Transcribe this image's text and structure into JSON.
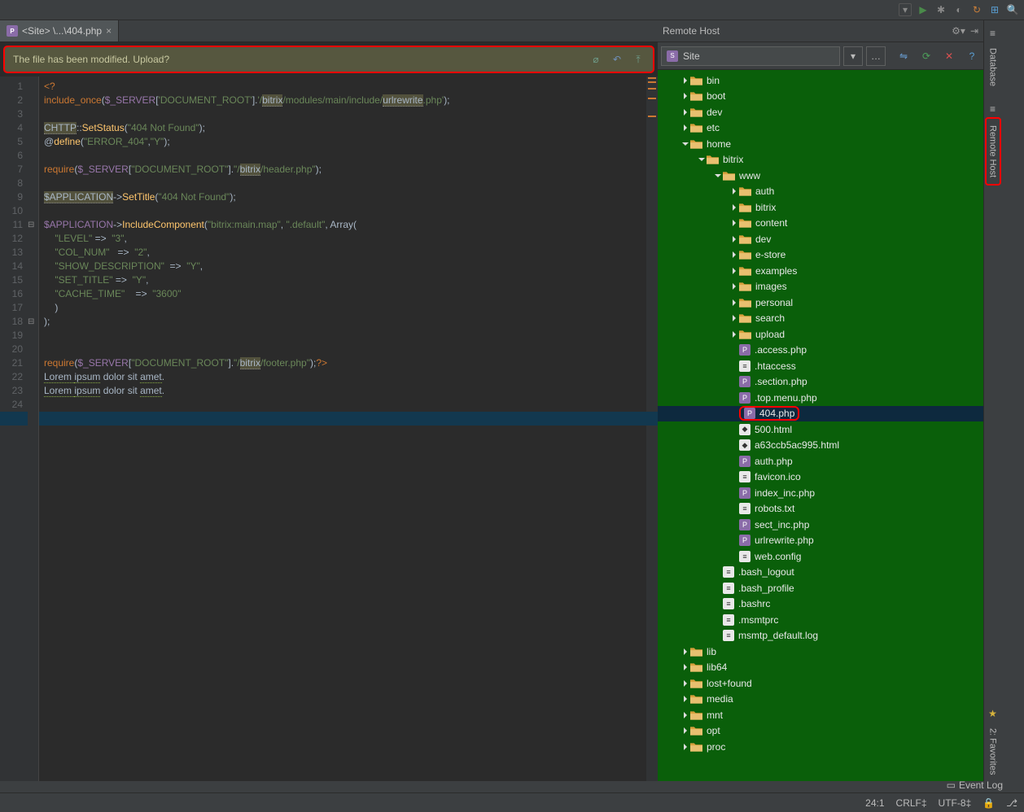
{
  "toolbar_icons": [
    "dropdown",
    "run",
    "debug",
    "cfg",
    "update",
    "grid",
    "search"
  ],
  "tab": {
    "label": "<Site> \\...\\404.php"
  },
  "banner": {
    "text": "The file has been modified. Upload?",
    "icons": [
      "diff-icon",
      "revert-icon",
      "upload-icon"
    ]
  },
  "code_lines": [
    {
      "n": 1,
      "segs": [
        {
          "t": "<?",
          "c": "kw"
        }
      ]
    },
    {
      "n": 2,
      "segs": [
        {
          "t": "include_once",
          "c": "kw"
        },
        {
          "t": "("
        },
        {
          "t": "$_SERVER",
          "c": "var"
        },
        {
          "t": "["
        },
        {
          "t": "'DOCUMENT_ROOT'",
          "c": "str"
        },
        {
          "t": "]."
        },
        {
          "t": "'/",
          "c": "str"
        },
        {
          "t": "bitrix",
          "c": "hl"
        },
        {
          "t": "/modules/main/include/",
          "c": "str"
        },
        {
          "t": "urlrewrite",
          "c": "hl"
        },
        {
          "t": ".php'",
          "c": "str"
        },
        {
          "t": ");"
        }
      ]
    },
    {
      "n": 3,
      "segs": []
    },
    {
      "n": 4,
      "segs": [
        {
          "t": "CHTTP",
          "c": "hl"
        },
        {
          "t": "::"
        },
        {
          "t": "SetStatus",
          "c": "fn"
        },
        {
          "t": "("
        },
        {
          "t": "\"404 Not Found\"",
          "c": "str"
        },
        {
          "t": ");"
        }
      ]
    },
    {
      "n": 5,
      "segs": [
        {
          "t": "@"
        },
        {
          "t": "define",
          "c": "fn"
        },
        {
          "t": "("
        },
        {
          "t": "\"ERROR_404\"",
          "c": "str"
        },
        {
          "t": ","
        },
        {
          "t": "\"Y\"",
          "c": "str"
        },
        {
          "t": ");"
        }
      ]
    },
    {
      "n": 6,
      "segs": []
    },
    {
      "n": 7,
      "segs": [
        {
          "t": "require",
          "c": "kw"
        },
        {
          "t": "("
        },
        {
          "t": "$_SERVER",
          "c": "var"
        },
        {
          "t": "["
        },
        {
          "t": "\"DOCUMENT_ROOT\"",
          "c": "str"
        },
        {
          "t": "]."
        },
        {
          "t": "\"/",
          "c": "str"
        },
        {
          "t": "bitrix",
          "c": "hl"
        },
        {
          "t": "/header.php\"",
          "c": "str"
        },
        {
          "t": ");"
        }
      ]
    },
    {
      "n": 8,
      "segs": []
    },
    {
      "n": 9,
      "segs": [
        {
          "t": "$APPLICATION",
          "c": "hl"
        },
        {
          "t": "->"
        },
        {
          "t": "SetTitle",
          "c": "fn"
        },
        {
          "t": "("
        },
        {
          "t": "\"404 Not Found\"",
          "c": "str"
        },
        {
          "t": ");"
        }
      ]
    },
    {
      "n": 10,
      "segs": []
    },
    {
      "n": 11,
      "segs": [
        {
          "t": "$APPLICATION",
          "c": "var"
        },
        {
          "t": "->"
        },
        {
          "t": "IncludeComponent",
          "c": "fn"
        },
        {
          "t": "("
        },
        {
          "t": "\"bitrix:main.map\"",
          "c": "str"
        },
        {
          "t": ", "
        },
        {
          "t": "\".default\"",
          "c": "str"
        },
        {
          "t": ", "
        },
        {
          "t": "Array",
          "c": ""
        },
        {
          "t": "("
        }
      ]
    },
    {
      "n": 12,
      "segs": [
        {
          "t": "    "
        },
        {
          "t": "\"LEVEL\"",
          "c": "str"
        },
        {
          "t": " =>  "
        },
        {
          "t": "\"3\"",
          "c": "str"
        },
        {
          "t": ","
        }
      ]
    },
    {
      "n": 13,
      "segs": [
        {
          "t": "    "
        },
        {
          "t": "\"COL_NUM\"",
          "c": "str"
        },
        {
          "t": "   =>  "
        },
        {
          "t": "\"2\"",
          "c": "str"
        },
        {
          "t": ","
        }
      ]
    },
    {
      "n": 14,
      "segs": [
        {
          "t": "    "
        },
        {
          "t": "\"SHOW_DESCRIPTION\"",
          "c": "str"
        },
        {
          "t": "  =>  "
        },
        {
          "t": "\"Y\"",
          "c": "str"
        },
        {
          "t": ","
        }
      ]
    },
    {
      "n": 15,
      "segs": [
        {
          "t": "    "
        },
        {
          "t": "\"SET_TITLE\"",
          "c": "str"
        },
        {
          "t": " =>  "
        },
        {
          "t": "\"Y\"",
          "c": "str"
        },
        {
          "t": ","
        }
      ]
    },
    {
      "n": 16,
      "segs": [
        {
          "t": "    "
        },
        {
          "t": "\"CACHE_TIME\"",
          "c": "str"
        },
        {
          "t": "    =>  "
        },
        {
          "t": "\"3600\"",
          "c": "str"
        }
      ]
    },
    {
      "n": 17,
      "segs": [
        {
          "t": "    )"
        }
      ]
    },
    {
      "n": 18,
      "segs": [
        {
          "t": ");"
        }
      ]
    },
    {
      "n": 19,
      "segs": []
    },
    {
      "n": 20,
      "segs": []
    },
    {
      "n": 21,
      "segs": [
        {
          "t": "require",
          "c": "kw"
        },
        {
          "t": "("
        },
        {
          "t": "$_SERVER",
          "c": "var"
        },
        {
          "t": "["
        },
        {
          "t": "\"DOCUMENT_ROOT\"",
          "c": "str"
        },
        {
          "t": "]."
        },
        {
          "t": "\"/",
          "c": "str"
        },
        {
          "t": "bitrix",
          "c": "hl"
        },
        {
          "t": "/footer.php\"",
          "c": "str"
        },
        {
          "t": ");"
        },
        {
          "t": "?>",
          "c": "kw"
        }
      ]
    },
    {
      "n": 22,
      "segs": [
        {
          "t": "Lorem ",
          "c": "typo"
        },
        {
          "t": "ipsum",
          "c": "typo"
        },
        {
          "t": " dolor sit "
        },
        {
          "t": "amet",
          "c": "typo"
        },
        {
          "t": "."
        }
      ]
    },
    {
      "n": 23,
      "segs": [
        {
          "t": "Lorem ",
          "c": "typo"
        },
        {
          "t": "ipsum",
          "c": "typo"
        },
        {
          "t": " dolor sit "
        },
        {
          "t": "amet",
          "c": "typo"
        },
        {
          "t": "."
        }
      ]
    },
    {
      "n": 24,
      "segs": []
    },
    {
      "n": 25,
      "segs": []
    }
  ],
  "marker_lines": [
    2,
    4,
    7,
    11,
    21
  ],
  "remote": {
    "title": "Remote Host",
    "combo": "Site",
    "toolbar_icons": [
      {
        "g": "⇋",
        "c": "#6aa0d8"
      },
      {
        "g": "⟳",
        "c": "#4da05a"
      },
      {
        "g": "✕",
        "c": "#d85050"
      },
      {
        "g": "?",
        "c": "#5a9fd4"
      }
    ],
    "tree": [
      {
        "d": 1,
        "a": "r",
        "t": "folder",
        "n": "bin"
      },
      {
        "d": 1,
        "a": "r",
        "t": "folder",
        "n": "boot"
      },
      {
        "d": 1,
        "a": "r",
        "t": "folder",
        "n": "dev"
      },
      {
        "d": 1,
        "a": "r",
        "t": "folder",
        "n": "etc"
      },
      {
        "d": 1,
        "a": "d",
        "t": "folder",
        "n": "home"
      },
      {
        "d": 2,
        "a": "d",
        "t": "folder",
        "n": "bitrix"
      },
      {
        "d": 3,
        "a": "d",
        "t": "folder",
        "n": "www"
      },
      {
        "d": 4,
        "a": "r",
        "t": "folder",
        "n": "auth"
      },
      {
        "d": 4,
        "a": "r",
        "t": "folder",
        "n": "bitrix"
      },
      {
        "d": 4,
        "a": "r",
        "t": "folder",
        "n": "content"
      },
      {
        "d": 4,
        "a": "r",
        "t": "folder",
        "n": "dev"
      },
      {
        "d": 4,
        "a": "r",
        "t": "folder",
        "n": "e-store"
      },
      {
        "d": 4,
        "a": "r",
        "t": "folder",
        "n": "examples"
      },
      {
        "d": 4,
        "a": "r",
        "t": "folder",
        "n": "images"
      },
      {
        "d": 4,
        "a": "r",
        "t": "folder",
        "n": "personal"
      },
      {
        "d": 4,
        "a": "r",
        "t": "folder",
        "n": "search"
      },
      {
        "d": 4,
        "a": "r",
        "t": "folder",
        "n": "upload"
      },
      {
        "d": 4,
        "a": "",
        "t": "php",
        "n": ".access.php"
      },
      {
        "d": 4,
        "a": "",
        "t": "txt",
        "n": ".htaccess"
      },
      {
        "d": 4,
        "a": "",
        "t": "php",
        "n": ".section.php"
      },
      {
        "d": 4,
        "a": "",
        "t": "php",
        "n": ".top.menu.php"
      },
      {
        "d": 4,
        "a": "",
        "t": "php",
        "n": "404.php",
        "sel": true
      },
      {
        "d": 4,
        "a": "",
        "t": "html",
        "n": "500.html"
      },
      {
        "d": 4,
        "a": "",
        "t": "html",
        "n": "a63ccb5ac995.html"
      },
      {
        "d": 4,
        "a": "",
        "t": "php",
        "n": "auth.php"
      },
      {
        "d": 4,
        "a": "",
        "t": "txt",
        "n": "favicon.ico"
      },
      {
        "d": 4,
        "a": "",
        "t": "php",
        "n": "index_inc.php"
      },
      {
        "d": 4,
        "a": "",
        "t": "txt",
        "n": "robots.txt"
      },
      {
        "d": 4,
        "a": "",
        "t": "php",
        "n": "sect_inc.php"
      },
      {
        "d": 4,
        "a": "",
        "t": "php",
        "n": "urlrewrite.php"
      },
      {
        "d": 4,
        "a": "",
        "t": "txt",
        "n": "web.config"
      },
      {
        "d": 3,
        "a": "",
        "t": "txt",
        "n": ".bash_logout"
      },
      {
        "d": 3,
        "a": "",
        "t": "txt",
        "n": ".bash_profile"
      },
      {
        "d": 3,
        "a": "",
        "t": "txt",
        "n": ".bashrc"
      },
      {
        "d": 3,
        "a": "",
        "t": "txt",
        "n": ".msmtprc"
      },
      {
        "d": 3,
        "a": "",
        "t": "txt",
        "n": "msmtp_default.log"
      },
      {
        "d": 1,
        "a": "r",
        "t": "folder",
        "n": "lib"
      },
      {
        "d": 1,
        "a": "r",
        "t": "folder",
        "n": "lib64"
      },
      {
        "d": 1,
        "a": "r",
        "t": "folder",
        "n": "lost+found"
      },
      {
        "d": 1,
        "a": "r",
        "t": "folder",
        "n": "media"
      },
      {
        "d": 1,
        "a": "r",
        "t": "folder",
        "n": "mnt"
      },
      {
        "d": 1,
        "a": "r",
        "t": "folder",
        "n": "opt"
      },
      {
        "d": 1,
        "a": "r",
        "t": "folder",
        "n": "proc"
      }
    ]
  },
  "sidebar": {
    "database": "Database",
    "remotehost": "Remote Host",
    "favorites": "2: Favorites"
  },
  "status": {
    "eventlog": "Event Log",
    "pos": "24:1",
    "le": "CRLF‡",
    "enc": "UTF-8‡",
    "lock": "🔒",
    "git": "⎇"
  }
}
